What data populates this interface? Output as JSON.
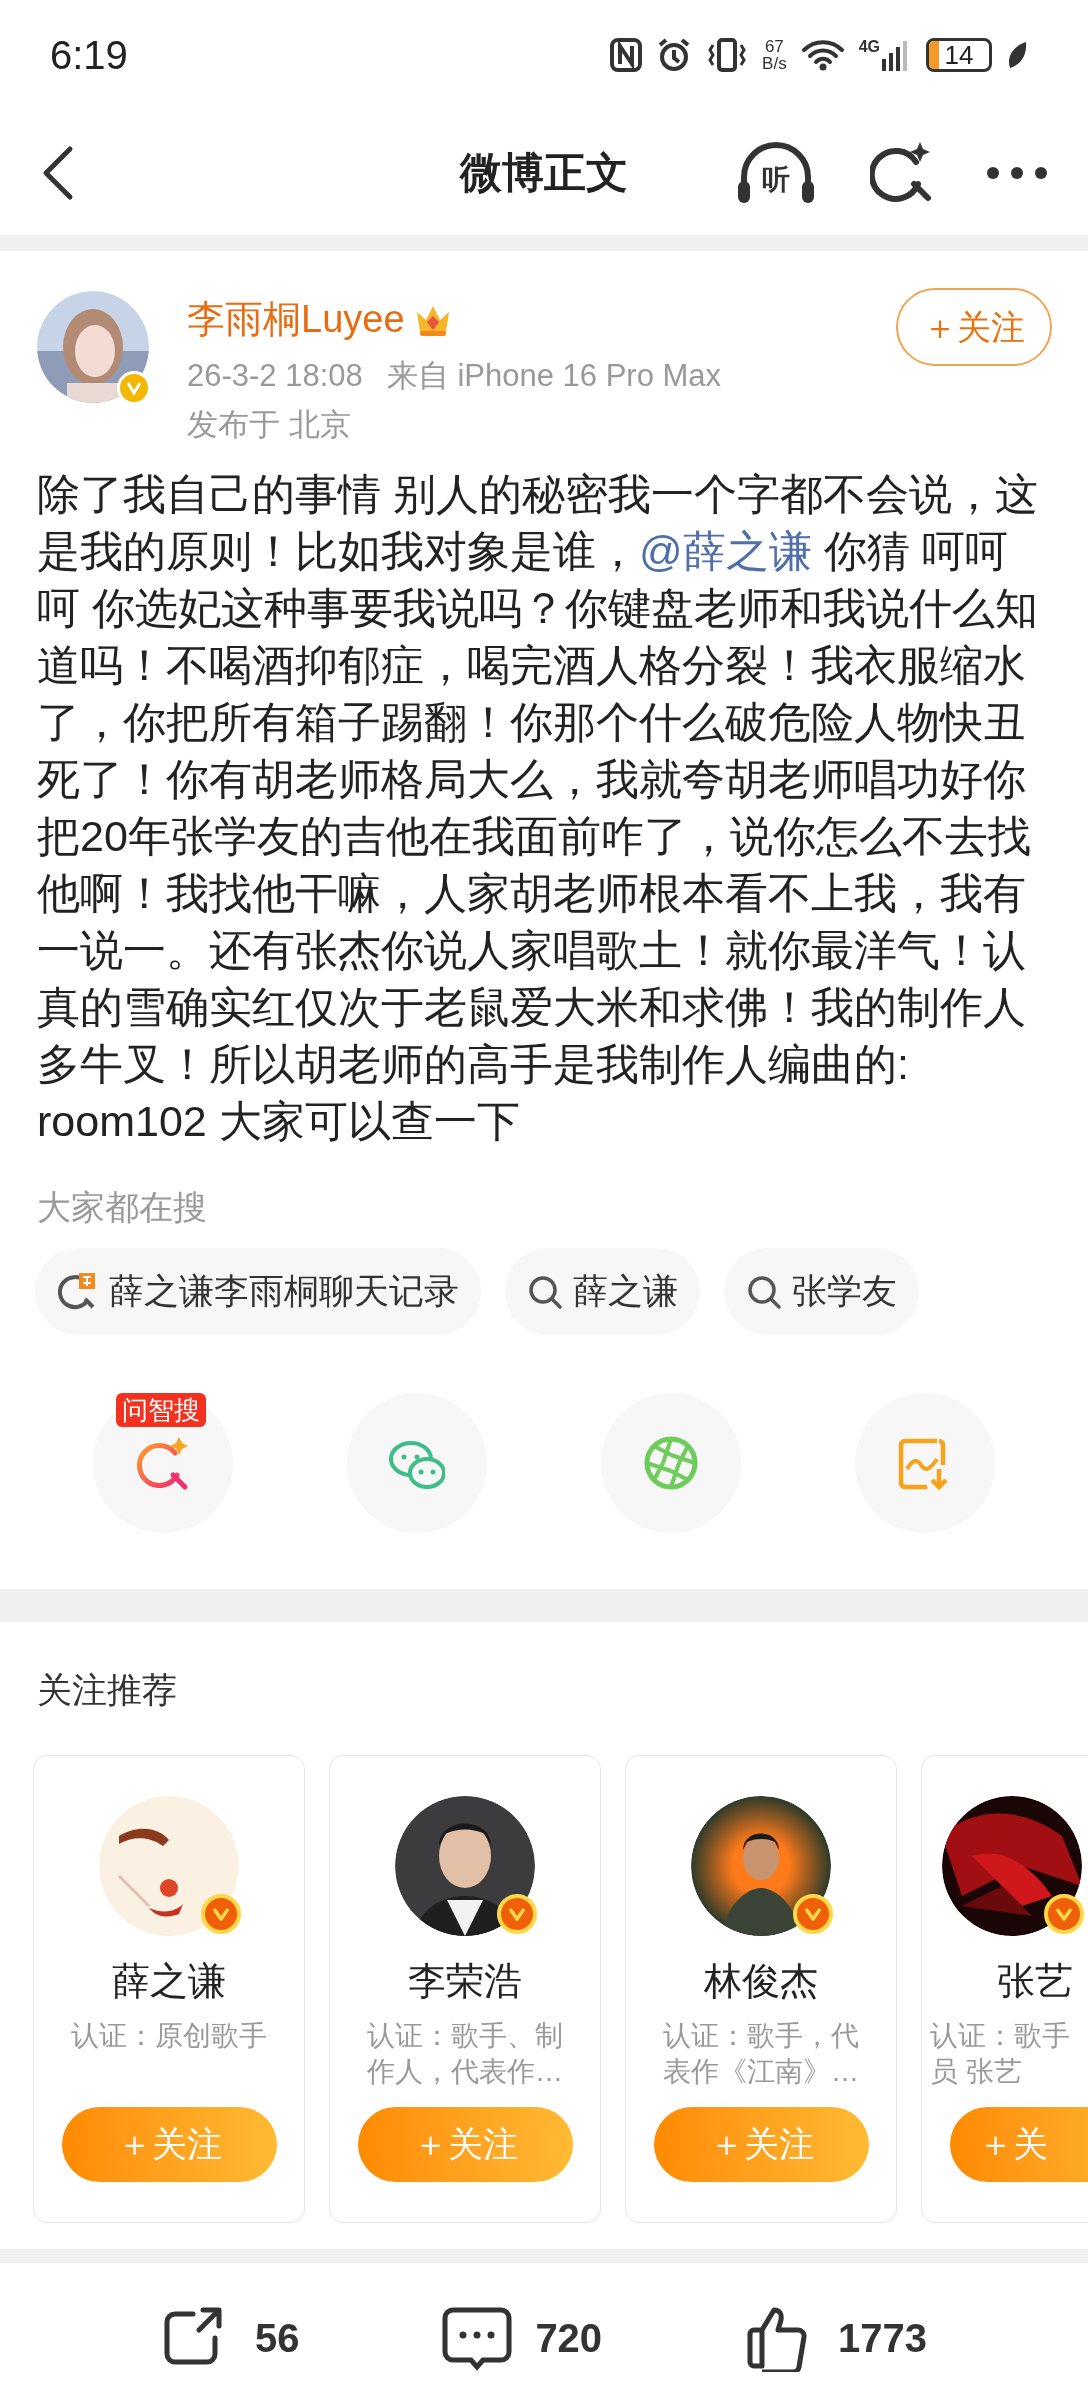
{
  "status_bar": {
    "time": "6:19",
    "speed_value": "67",
    "speed_unit": "B/s",
    "network": "4G",
    "battery": "14"
  },
  "header": {
    "title": "微博正文",
    "listen_label": "听"
  },
  "post": {
    "author": "李雨桐Luyee",
    "verified": true,
    "follow_button": "＋关注",
    "time": "26-3-2 18:08",
    "source": "来自 iPhone 16 Pro Max",
    "location": "发布于 北京",
    "text_before": "除了我自己的事情 别人的秘密我一个字都不会说，这是我的原则！比如我对象是谁，",
    "mention": "@薛之谦",
    "text_after": " 你猜 呵呵呵 你选妃这种事要我说吗？你键盘老师和我说什么知道吗！不喝酒抑郁症，喝完酒人格分裂！我衣服缩水了，你把所有箱子踢翻！你那个什么破危险人物快丑死了！你有胡老师格局大么，我就夸胡老师唱功好你把20年张学友的吉他在我面前咋了，说你怎么不去找他啊！我找他干嘛，人家胡老师根本看不上我，我有一说一。还有张杰你说人家唱歌土！就你最洋气！认真的雪确实红仅次于老鼠爱大米和求佛！我的制作人多牛叉！所以胡老师的高手是我制作人编曲的: room102 大家可以查一下"
  },
  "hot_searches": {
    "title": "大家都在搜",
    "items": [
      {
        "kind": "hot",
        "label": "薛之谦李雨桐聊天记录"
      },
      {
        "kind": "search",
        "label": "薛之谦"
      },
      {
        "kind": "search",
        "label": "张学友"
      }
    ]
  },
  "share_actions": [
    {
      "kind": "ai_search",
      "badge": "问智搜"
    },
    {
      "kind": "wechat"
    },
    {
      "kind": "moments"
    },
    {
      "kind": "save_image"
    }
  ],
  "recommend": {
    "title": "关注推荐",
    "cards": [
      {
        "name": "薛之谦",
        "desc_lines": [
          "认证：原创歌手"
        ],
        "button": "＋关注",
        "partial": false
      },
      {
        "name": "李荣浩",
        "desc_lines": [
          "认证：歌手、制",
          "作人，代表作…"
        ],
        "button": "＋关注",
        "partial": false
      },
      {
        "name": "林俊杰",
        "desc_lines": [
          "认证：歌手，代",
          "表作《江南》…"
        ],
        "button": "＋关注",
        "partial": false
      },
      {
        "name": "张艺",
        "desc_lines": [
          "认证：歌手",
          "员 张艺"
        ],
        "button": "＋关",
        "partial": true
      }
    ]
  },
  "actions": [
    {
      "kind": "repost",
      "count": "56"
    },
    {
      "kind": "comment",
      "count": "720"
    },
    {
      "kind": "like",
      "count": "1773"
    }
  ]
}
